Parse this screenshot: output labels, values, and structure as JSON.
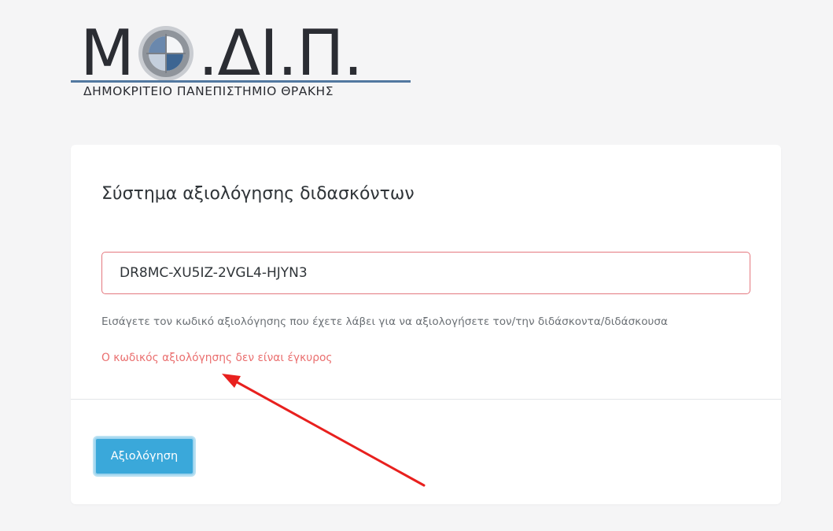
{
  "logo": {
    "letter_m": "Μ",
    "rest": ".ΔΙ.Π.",
    "subtitle": "ΔΗΜΟΚΡΙΤΕΙΟ ΠΑΝΕΠΙΣΤΗΜΙΟ ΘΡΑΚΗΣ"
  },
  "card": {
    "title": "Σύστημα αξιολόγησης διδασκόντων",
    "code_input": {
      "value": "DR8MC-XU5IZ-2VGL4-HJYN3",
      "placeholder": ""
    },
    "help_text": "Εισάγετε τον κωδικό αξιολόγησης που έχετε λάβει για να αξιολογήσετε τον/την διδάσκοντα/διδάσκουσα",
    "error_text": "Ο κωδικός αξιολόγησης δεν είναι έγκυρος",
    "submit_label": "Αξιολόγηση"
  },
  "colors": {
    "background": "#f5f5f6",
    "card": "#ffffff",
    "error": "#ea6f6f",
    "input_border_error": "#e4787f",
    "button": "#3aa8da",
    "logo_rule": "#5278a0",
    "annotation_arrow": "#e8201e"
  }
}
